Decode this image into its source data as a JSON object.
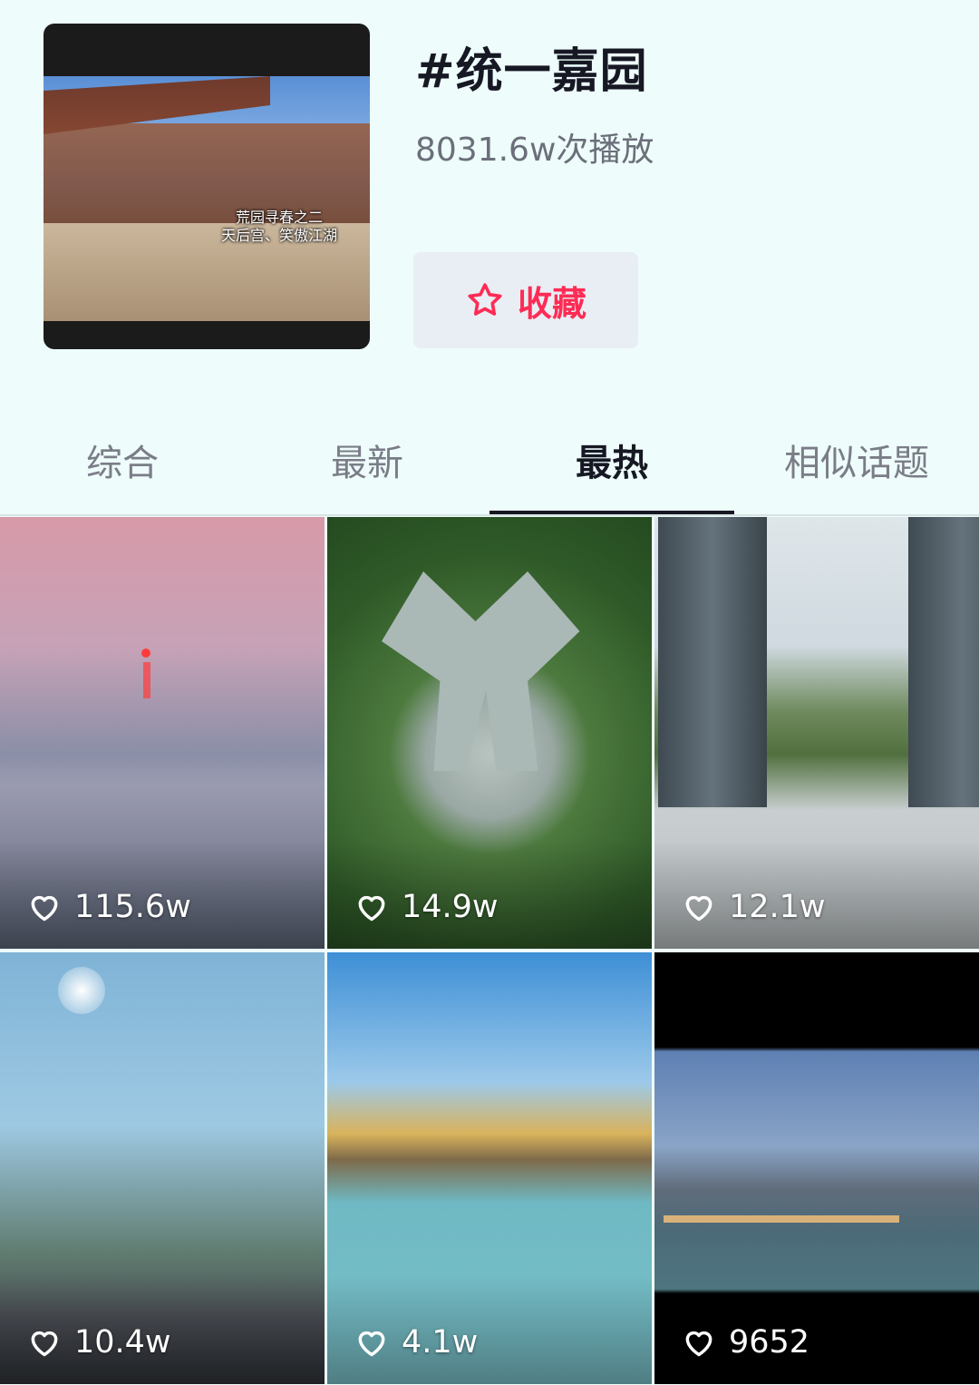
{
  "topic": {
    "title": "#统一嘉园",
    "play_count": "8031.6w次播放",
    "cover_caption_line1": "荒园寻春之二",
    "cover_caption_line2": "天后宫、笑傲江湖",
    "favorite_label": "收藏"
  },
  "colors": {
    "background": "#eefcfb",
    "accent": "#fe2c55",
    "text_primary": "#161823",
    "text_secondary": "#6b6f7a"
  },
  "tabs": [
    {
      "label": "综合",
      "active": false
    },
    {
      "label": "最新",
      "active": false
    },
    {
      "label": "最热",
      "active": true
    },
    {
      "label": "相似话题",
      "active": false
    }
  ],
  "videos": [
    {
      "likes": "115.6w"
    },
    {
      "likes": "14.9w"
    },
    {
      "likes": "12.1w"
    },
    {
      "likes": "10.4w"
    },
    {
      "likes": "4.1w"
    },
    {
      "likes": "9652"
    }
  ],
  "icons": {
    "favorite": "star-outline-icon",
    "likes": "heart-outline-icon"
  }
}
